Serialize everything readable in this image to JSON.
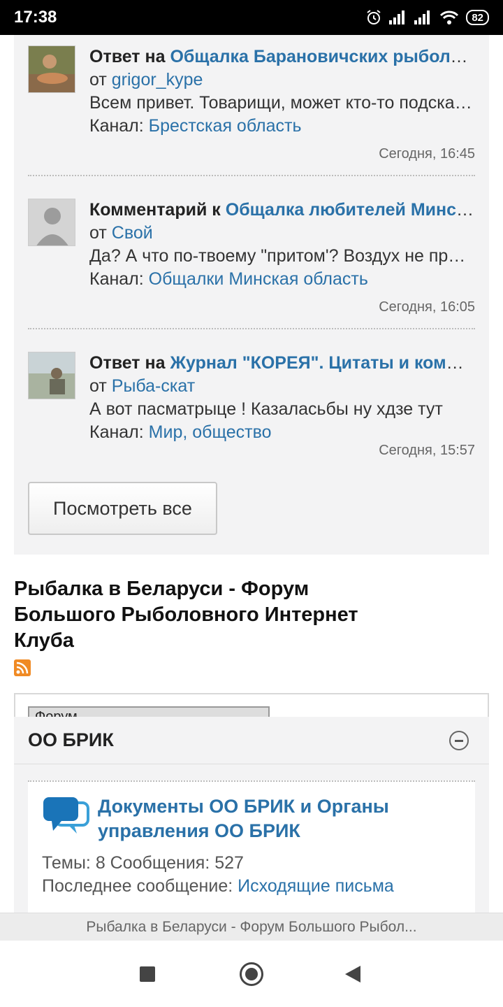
{
  "status_bar": {
    "time": "17:38",
    "battery": "82"
  },
  "activity": {
    "items": [
      {
        "prefix": "Ответ на",
        "title": "Общалка Барановичских рыболовов",
        "from_label": "от",
        "author": "grigor_kype",
        "snippet": "Всем привет. Товарищи, может кто-то подскажет",
        "channel_label": "Канал:",
        "channel": "Брестская область",
        "time": "Сегодня, 16:45"
      },
      {
        "prefix": "Комментарий к",
        "title": "Общалка любителей Минской области",
        "from_label": "от",
        "author": "Свой",
        "snippet": "Да? А что по-твоему \"притом'? Воздух не при чём",
        "channel_label": "Канал:",
        "channel": "Общалки Минская область",
        "time": "Сегодня, 16:05"
      },
      {
        "prefix": "Ответ на",
        "title": "Журнал \"КОРЕЯ\". Цитаты и комментарии",
        "from_label": "от",
        "author": "Рыба-скат",
        "snippet": "А вот пасматрыце ! Казаласьбы ну хдзе тут",
        "channel_label": "Канал:",
        "channel": "Мир, общество",
        "time": "Сегодня, 15:57"
      }
    ],
    "view_all_label": "Посмотреть все"
  },
  "forum": {
    "title": "Рыбалка в Беларуси - Форум Большого Рыболовного Интернет Клуба",
    "select_value": "Форум",
    "section_title": "ОО БРИК",
    "row": {
      "name": "Документы ОО БРИК и Органы управления ОО БРИК",
      "stats": "Темы: 8 Сообщения: 527",
      "last_label": "Последнее сообщение:",
      "last_link": "Исходящие письма"
    }
  },
  "browser": {
    "page_title": "Рыбалка в Беларуси - Форум Большого Рыбол..."
  },
  "icons": {
    "alarm": "alarm-icon",
    "signal": "signal-icon",
    "wifi": "wifi-icon",
    "rss": "rss-icon",
    "forum": "chat-bubbles-icon",
    "collapse": "collapse-icon"
  },
  "colors": {
    "link": "#2a71a8",
    "panel_bg": "#f3f3f4",
    "rss": "#f08a24"
  }
}
